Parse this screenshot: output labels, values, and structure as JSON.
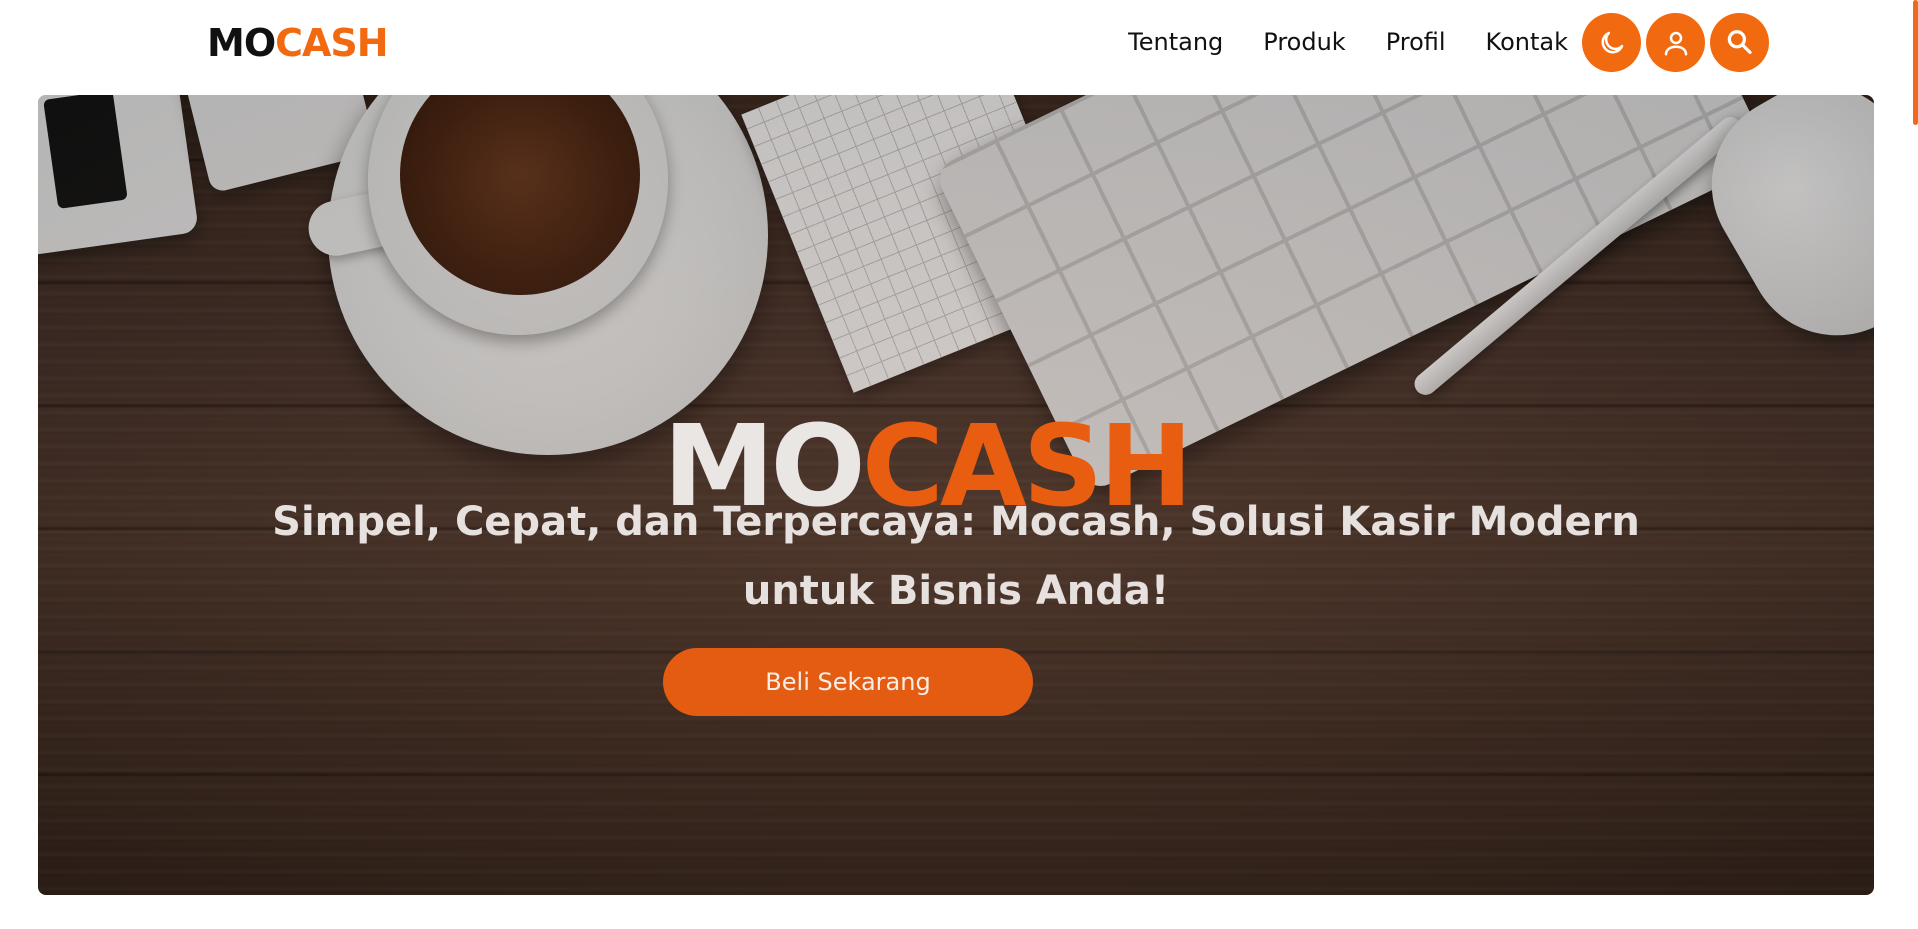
{
  "navbar": {
    "logo": {
      "part1": "MO",
      "part2": "CASH"
    },
    "links": [
      "Tentang",
      "Produk",
      "Profil",
      "Kontak"
    ],
    "actions": [
      {
        "icon": "moon-icon"
      },
      {
        "icon": "user-icon"
      },
      {
        "icon": "search-icon"
      }
    ]
  },
  "hero": {
    "title": {
      "part1": "MO",
      "part2": "CASH"
    },
    "subtitle": "Simpel, Cepat, dan Terpercaya: Mocash, Solusi Kasir Modern untuk Bisnis Anda!",
    "cta_label": "Beli Sekarang"
  },
  "colors": {
    "accent": "#f26a10",
    "text_dark": "#111111",
    "hero_text": "#e6e1de"
  }
}
